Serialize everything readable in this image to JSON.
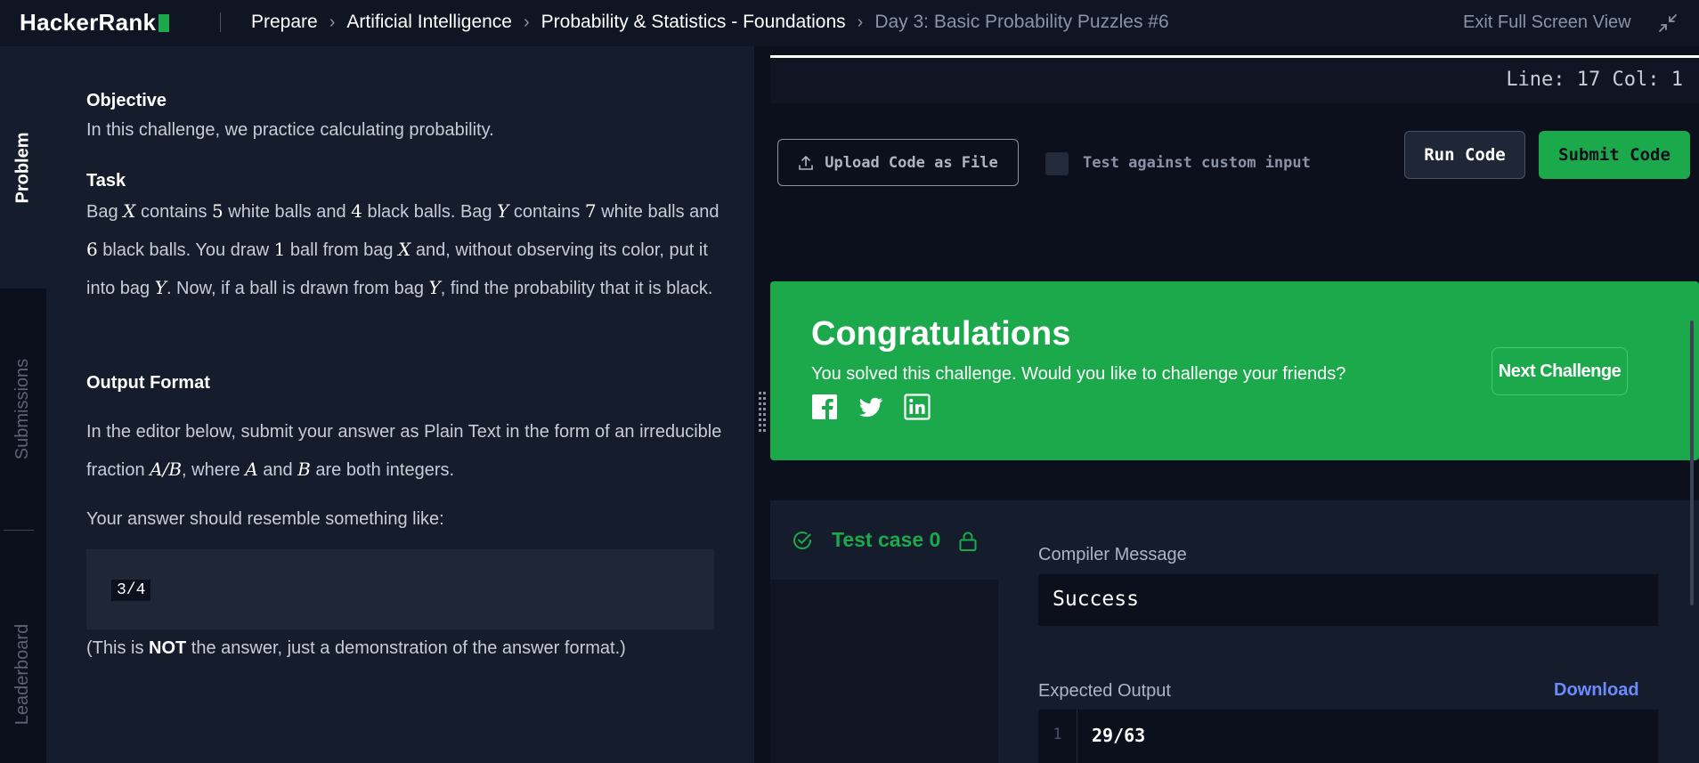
{
  "header": {
    "logo": "HackerRank",
    "breadcrumbs": [
      "Prepare",
      "Artificial Intelligence",
      "Probability & Statistics - Foundations",
      "Day 3: Basic Probability Puzzles #6"
    ],
    "exit_fullscreen": "Exit Full Screen View"
  },
  "sidetabs": [
    "Problem",
    "Submissions",
    "Leaderboard"
  ],
  "problem": {
    "objective_heading": "Objective",
    "objective_text": "In this challenge, we practice calculating probability.",
    "task_heading": "Task",
    "task": {
      "t1": "Bag ",
      "v1": "X",
      "t2": " contains ",
      "n1": "5",
      "t3": " white balls and ",
      "n2": "4",
      "t4": " black balls. Bag ",
      "v2": "Y",
      "t5": " contains ",
      "n3": "7",
      "t6": " white balls and ",
      "n4": "6",
      "t7": " black balls. You draw ",
      "n5": "1",
      "t8": " ball from bag ",
      "v3": "X",
      "t9": " and, without observing its color, put it into bag ",
      "v4": "Y",
      "t10": ". Now, if a ball is drawn from bag ",
      "v5": "Y",
      "t11": ", find the probability that it is black."
    },
    "output_heading": "Output Format",
    "output": {
      "t1": "In the editor below, submit your answer as Plain Text in the form of an irreducible fraction ",
      "m1": "A/B",
      "t2": ", where ",
      "m2": "A",
      "t3": " and ",
      "m3": "B",
      "t4": " are both integers."
    },
    "resemble_text": "Your answer should resemble something like:",
    "example_answer": "3/4",
    "note": {
      "pre": "(This is ",
      "bold": "NOT",
      "post": " the answer, just a demonstration of the answer format.)"
    }
  },
  "editor": {
    "line_col": "Line: 17 Col: 1",
    "upload_label": "Upload Code as File",
    "custom_input_label": "Test against custom input",
    "custom_input_checked": false,
    "run_label": "Run Code",
    "submit_label": "Submit Code"
  },
  "congrats": {
    "title": "Congratulations",
    "subtitle": "You solved this challenge. Would you like to challenge your friends?",
    "next_label": "Next Challenge",
    "social": [
      "facebook-icon",
      "twitter-icon",
      "linkedin-icon"
    ]
  },
  "results": {
    "testcase_label": "Test case 0",
    "compiler_label": "Compiler Message",
    "compiler_value": "Success",
    "expected_label": "Expected Output",
    "download_label": "Download",
    "expected_line_no": "1",
    "expected_value": "29/63"
  },
  "colors": {
    "accent_green": "#1ba94c",
    "link_blue": "#6b8cff",
    "bg": "#0b101c",
    "panel": "#151c2b"
  }
}
